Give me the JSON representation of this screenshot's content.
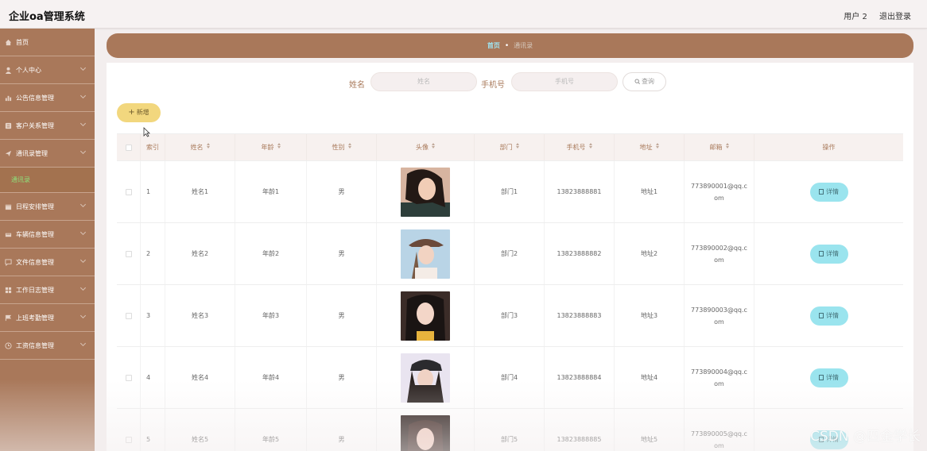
{
  "app": {
    "title": "企业oa管理系统",
    "user": "用户 2",
    "logout": "退出登录"
  },
  "sidebar": {
    "items": [
      {
        "label": "首页",
        "icon": "home-icon"
      },
      {
        "label": "个人中心",
        "icon": "user-icon"
      },
      {
        "label": "公告信息管理",
        "icon": "bar-chart-icon"
      },
      {
        "label": "客户关系管理",
        "icon": "contacts-icon"
      },
      {
        "label": "通讯录管理",
        "icon": "send-icon"
      },
      {
        "label": "日程安排管理",
        "icon": "calendar-icon"
      },
      {
        "label": "车辆信息管理",
        "icon": "car-icon"
      },
      {
        "label": "文件信息管理",
        "icon": "chat-icon"
      },
      {
        "label": "工作日志管理",
        "icon": "grid-icon"
      },
      {
        "label": "上班考勤管理",
        "icon": "flag-icon"
      },
      {
        "label": "工资信息管理",
        "icon": "clock-icon"
      }
    ],
    "sub_item": "通讯录"
  },
  "breadcrumb": {
    "home": "首页",
    "current": "通讯录"
  },
  "search": {
    "name_label": "姓名",
    "name_placeholder": "姓名",
    "phone_label": "手机号",
    "phone_placeholder": "手机号",
    "query_button": "查询"
  },
  "toolbar": {
    "add_label": "新增"
  },
  "table": {
    "headers": [
      "索引",
      "姓名",
      "年龄",
      "性别",
      "头像",
      "部门",
      "手机号",
      "地址",
      "邮箱",
      "操作"
    ],
    "detail_label": "详情",
    "rows": [
      {
        "idx": "1",
        "name": "姓名1",
        "age": "年龄1",
        "gender": "男",
        "dept": "部门1",
        "phone": "13823888881",
        "addr": "地址1",
        "email": "773890001@qq.com"
      },
      {
        "idx": "2",
        "name": "姓名2",
        "age": "年龄2",
        "gender": "男",
        "dept": "部门2",
        "phone": "13823888882",
        "addr": "地址2",
        "email": "773890002@qq.com"
      },
      {
        "idx": "3",
        "name": "姓名3",
        "age": "年龄3",
        "gender": "男",
        "dept": "部门3",
        "phone": "13823888883",
        "addr": "地址3",
        "email": "773890003@qq.com"
      },
      {
        "idx": "4",
        "name": "姓名4",
        "age": "年龄4",
        "gender": "男",
        "dept": "部门4",
        "phone": "13823888884",
        "addr": "地址4",
        "email": "773890004@qq.com"
      },
      {
        "idx": "5",
        "name": "姓名5",
        "age": "年龄5",
        "gender": "男",
        "dept": "部门5",
        "phone": "13823888885",
        "addr": "地址5",
        "email": "773890005@qq.com"
      }
    ]
  },
  "watermark": "CSDN @四金学长"
}
